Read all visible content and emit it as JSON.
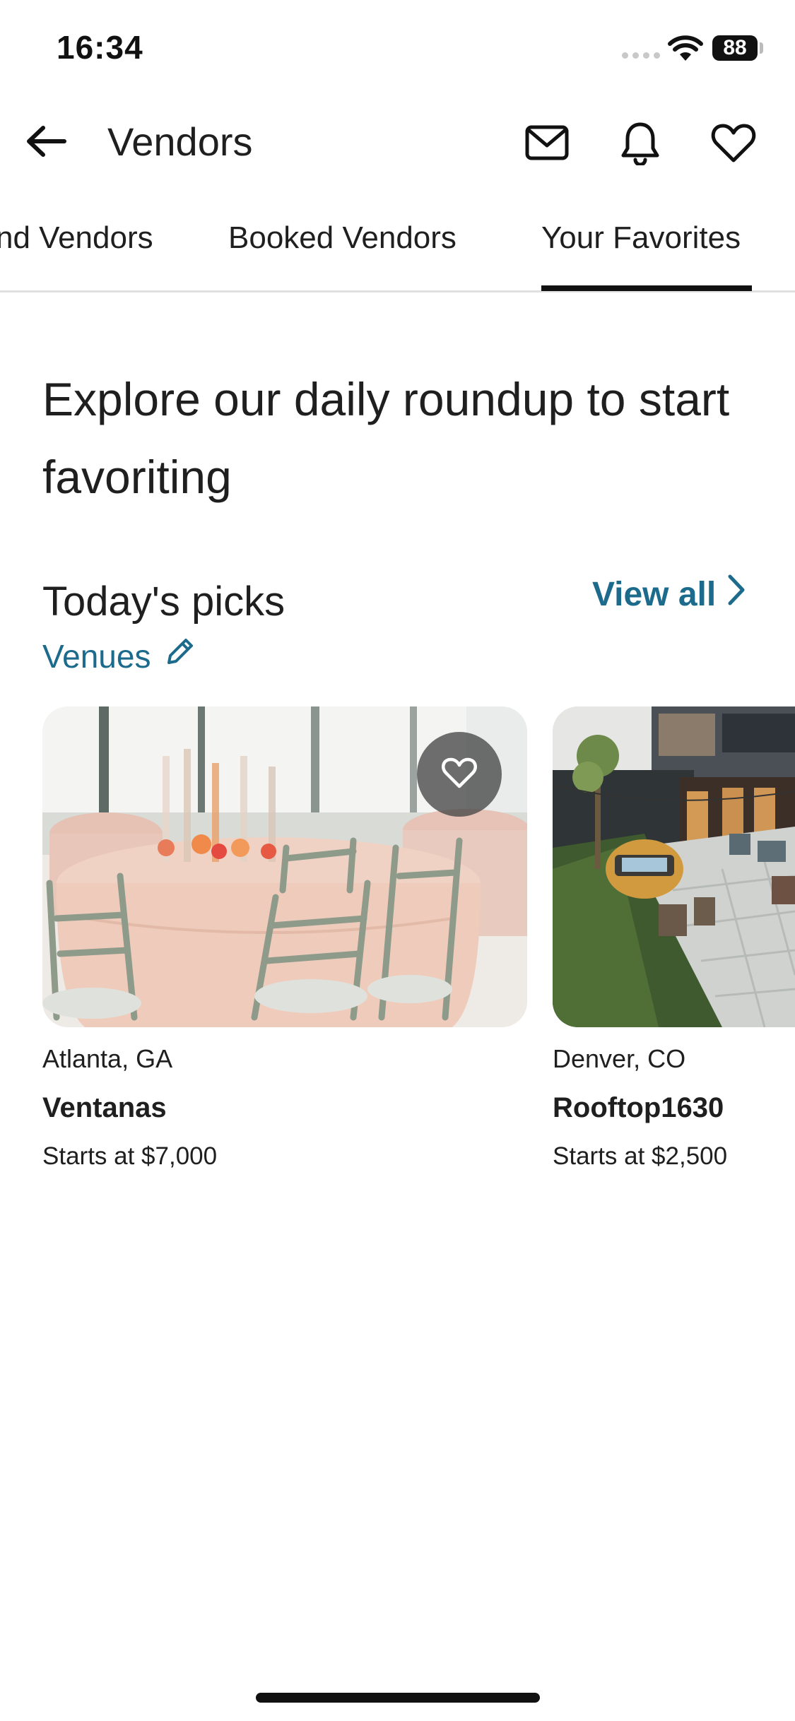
{
  "status_bar": {
    "time": "16:34",
    "battery": "88",
    "icons": [
      "signal-icon",
      "wifi-icon",
      "battery-icon"
    ]
  },
  "header": {
    "title": "Vendors",
    "icons": [
      "back-arrow-icon",
      "mail-icon",
      "bell-icon",
      "heart-icon"
    ]
  },
  "tabs": [
    {
      "label": "Find Vendors",
      "visible_label": "nd Vendors",
      "active": false
    },
    {
      "label": "Booked Vendors",
      "visible_label": "Booked Vendors",
      "active": false
    },
    {
      "label": "Your Favorites",
      "visible_label": "Your Favorites",
      "active": true
    }
  ],
  "headline": "Explore our daily roundup to start favoriting",
  "section": {
    "title": "Today's picks",
    "category": "Venues",
    "category_icon": "pencil-icon",
    "view_all": "View all",
    "view_all_icon": "chevron-right-icon"
  },
  "cards": [
    {
      "location": "Atlanta, GA",
      "name": "Ventanas",
      "price": "Starts at $7,000",
      "favorite_icon": "heart-outline-icon"
    },
    {
      "location": "Denver, CO",
      "name": "Rooftop1630",
      "price": "Starts at $2,500"
    }
  ],
  "colors": {
    "accent": "#1d6b8c",
    "text": "#1f1f1f",
    "tab_indicator": "#111111",
    "divider": "#e0e0e0"
  }
}
